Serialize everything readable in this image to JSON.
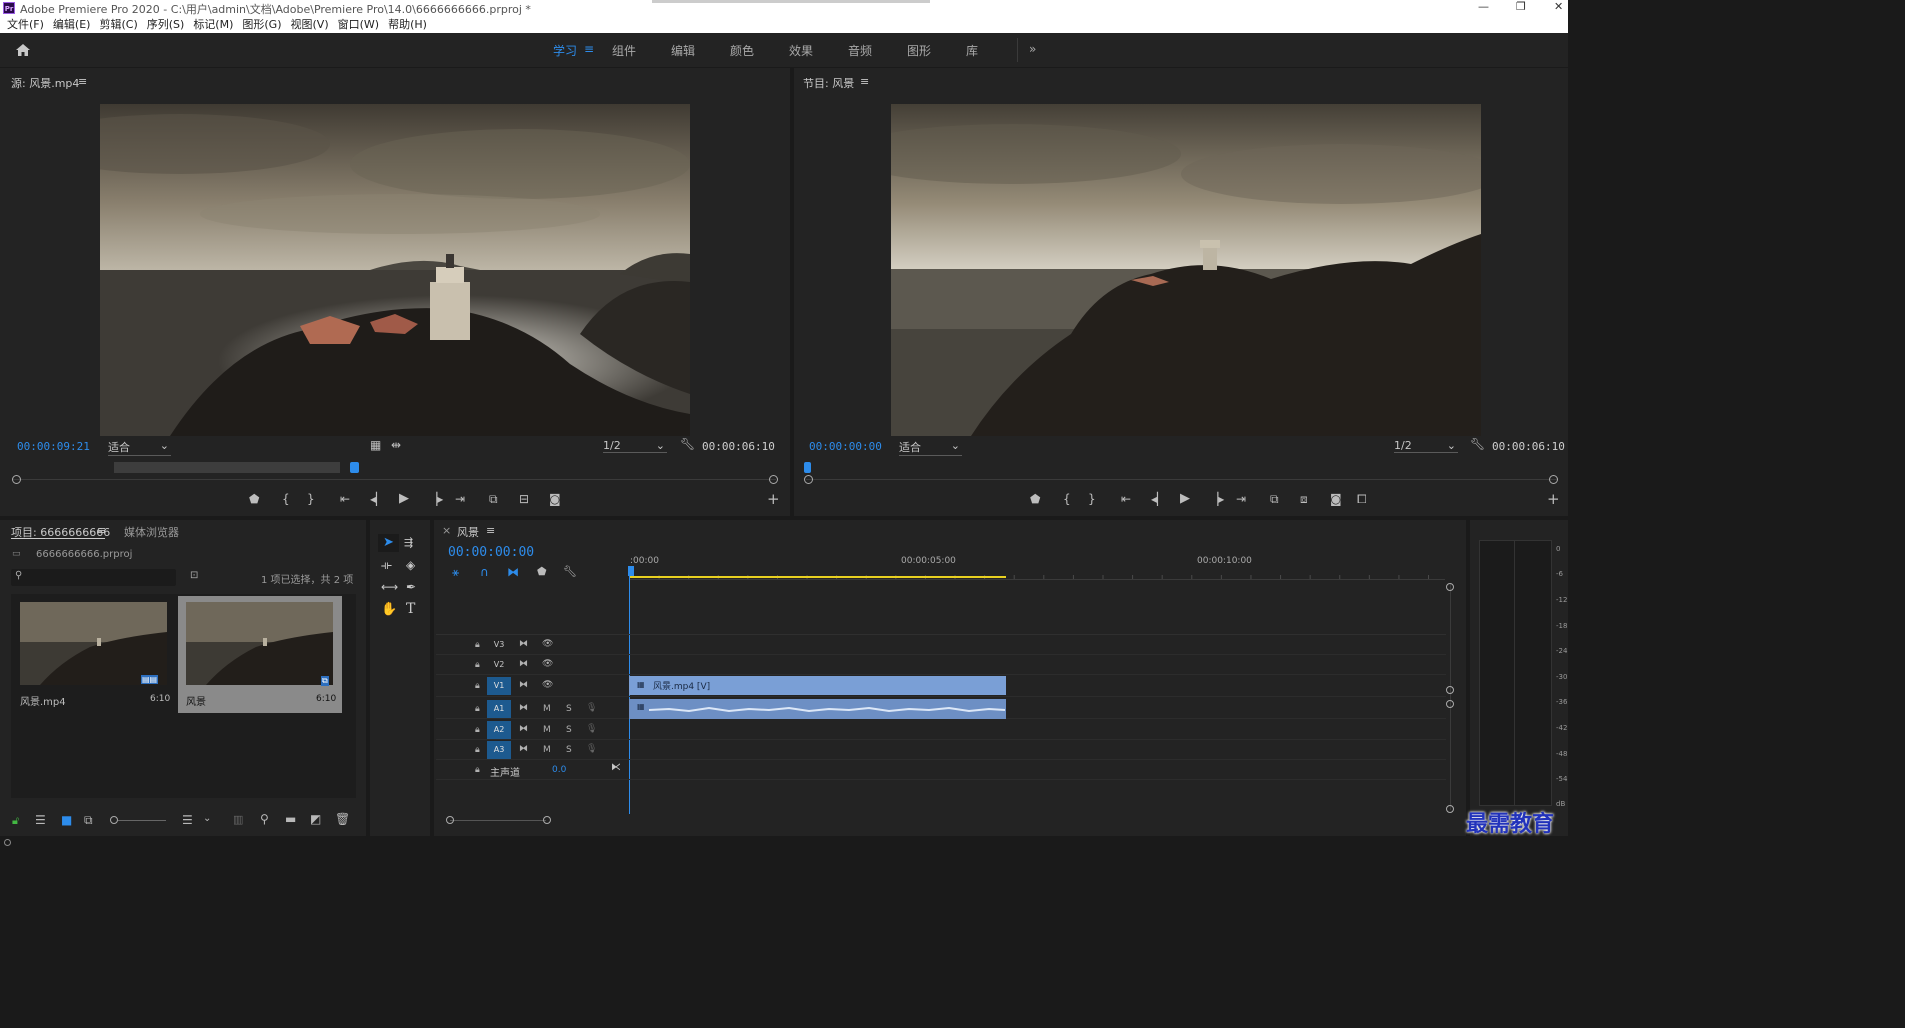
{
  "app": {
    "title": "Adobe Premiere Pro 2020 - C:\\用户\\admin\\文档\\Adobe\\Premiere Pro\\14.0\\6666666666.prproj *",
    "icon_label": "Pr"
  },
  "menu": [
    "文件(F)",
    "编辑(E)",
    "剪辑(C)",
    "序列(S)",
    "标记(M)",
    "图形(G)",
    "视图(V)",
    "窗口(W)",
    "帮助(H)"
  ],
  "workspaces": [
    "学习",
    "组件",
    "编辑",
    "颜色",
    "效果",
    "音频",
    "图形",
    "库"
  ],
  "workspace_active": "学习",
  "source": {
    "title": "源: 风景.mp4",
    "timecode": "00:00:09:21",
    "fit": "适合",
    "resolution": "1/2",
    "duration": "00:00:06:10"
  },
  "program": {
    "title": "节目: 风景",
    "timecode": "00:00:00:00",
    "fit": "适合",
    "resolution": "1/2",
    "duration": "00:00:06:10"
  },
  "project": {
    "tab": "项目: 6666666666",
    "tab2": "媒体浏览器",
    "file": "6666666666.prproj",
    "status": "1 项已选择，共 2 项",
    "items": [
      {
        "name": "风景.mp4",
        "duration": "6:10"
      },
      {
        "name": "风景",
        "duration": "6:10"
      }
    ]
  },
  "timeline": {
    "tab": "风景",
    "timecode": "00:00:00:00",
    "ruler": [
      ":00:00",
      "00:00:05:00",
      "00:00:10:00"
    ],
    "video_tracks": [
      "V3",
      "V2",
      "V1"
    ],
    "audio_tracks": [
      "A1",
      "A2",
      "A3"
    ],
    "track_m": "M",
    "track_s": "S",
    "master": "主声道",
    "master_value": "0.0",
    "clip_video": "风景.mp4 [V]"
  },
  "meter": [
    "0",
    "-6",
    "-12",
    "-18",
    "-24",
    "-30",
    "-36",
    "-42",
    "-48",
    "-54",
    "dB"
  ],
  "watermark": "最需教育",
  "colors": {
    "accent": "#2d8ceb",
    "clip": "#7a9fd6",
    "track_on": "#1d5a8f",
    "work_area": "#e8d020"
  }
}
